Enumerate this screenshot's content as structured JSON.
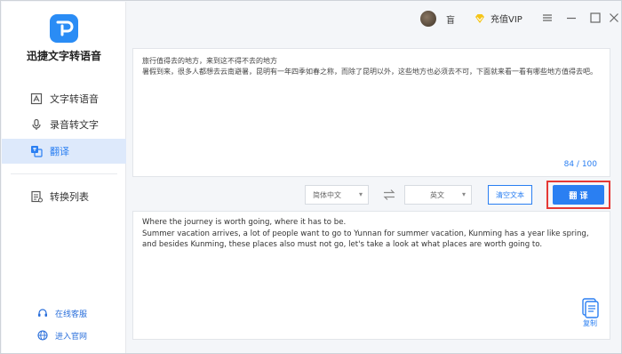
{
  "app": {
    "name": "迅捷文字转语音"
  },
  "sidebar": {
    "items": [
      {
        "label": "文字转语音",
        "icon": "text-to-speech-icon",
        "active": false
      },
      {
        "label": "录音转文字",
        "icon": "microphone-icon",
        "active": false
      },
      {
        "label": "翻译",
        "icon": "translate-icon",
        "active": true
      },
      {
        "label": "转换列表",
        "icon": "list-icon",
        "active": false
      }
    ],
    "footer": [
      {
        "label": "在线客服",
        "icon": "headset-icon"
      },
      {
        "label": "进入官网",
        "icon": "globe-icon"
      }
    ]
  },
  "topbar": {
    "user_name": "盲",
    "vip_label": "充值VIP",
    "window_controls": [
      "settings-icon",
      "minimize-icon",
      "maximize-icon",
      "close-icon"
    ]
  },
  "source": {
    "text": "旅行值得去的地方，来到这不得不去的地方\n暑假到来，很多人都想去云南避暑，昆明有一年四季如春之称，而除了昆明以外，这些地方也必须去不可，下面就来看一看有哪些地方值得去吧。",
    "counter": "84 / 100"
  },
  "toolbar": {
    "source_lang": "简体中文",
    "target_lang": "英文",
    "clear_label": "清空文本",
    "translate_label": "翻 译"
  },
  "result": {
    "text": "Where the journey is worth going, where it has to be.\nSummer vacation arrives, a lot of people want to go to Yunnan for summer vacation, Kunming has a year like spring, and besides Kunming, these places also must not go, let's take a look at what places are worth going to.",
    "copy_label": "复制"
  },
  "colors": {
    "accent": "#2a7ff2",
    "highlight_border": "#e53935",
    "active_bg": "#dde9fb"
  }
}
